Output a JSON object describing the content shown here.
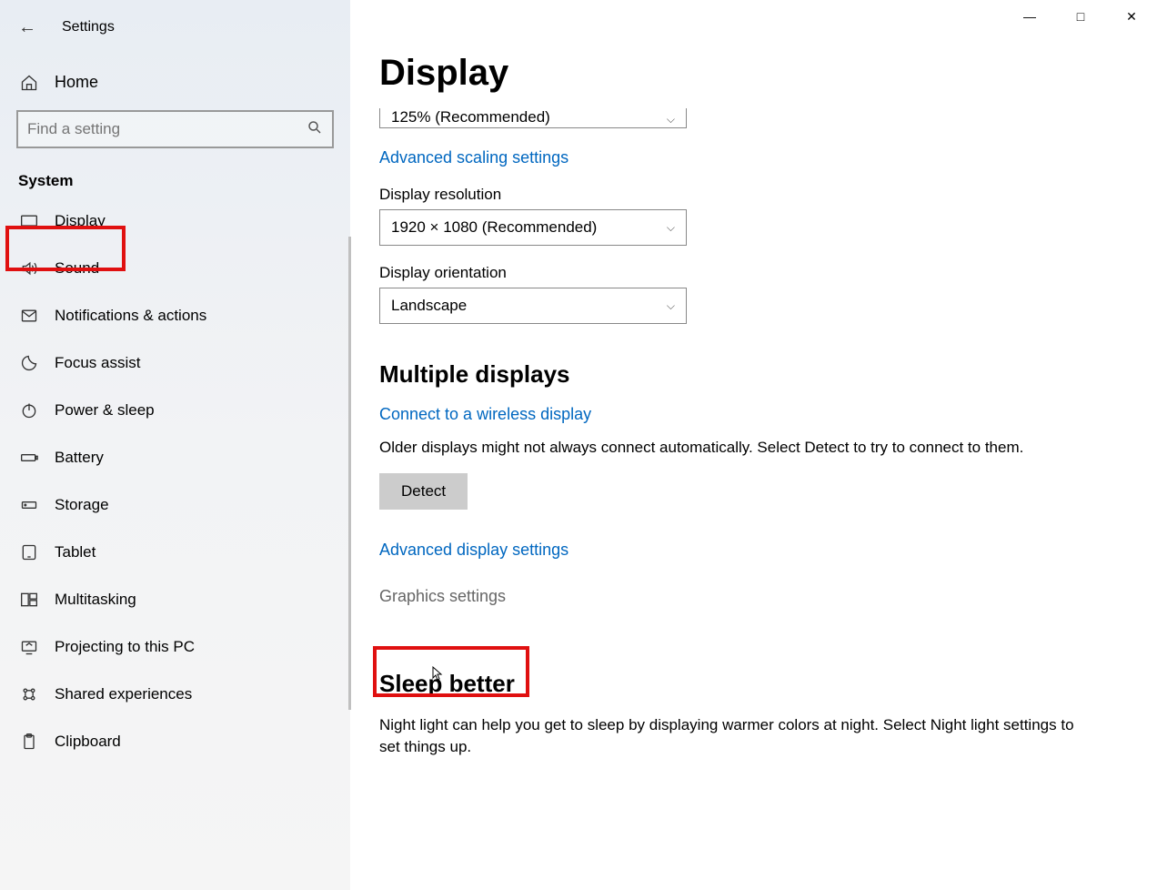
{
  "app_title": "Settings",
  "home_label": "Home",
  "search_placeholder": "Find a setting",
  "section_header": "System",
  "nav": [
    {
      "label": "Display"
    },
    {
      "label": "Sound"
    },
    {
      "label": "Notifications & actions"
    },
    {
      "label": "Focus assist"
    },
    {
      "label": "Power & sleep"
    },
    {
      "label": "Battery"
    },
    {
      "label": "Storage"
    },
    {
      "label": "Tablet"
    },
    {
      "label": "Multitasking"
    },
    {
      "label": "Projecting to this PC"
    },
    {
      "label": "Shared experiences"
    },
    {
      "label": "Clipboard"
    }
  ],
  "page": {
    "title": "Display",
    "scale_value": "125% (Recommended)",
    "adv_scaling_link": "Advanced scaling settings",
    "resolution_label": "Display resolution",
    "resolution_value": "1920 × 1080 (Recommended)",
    "orientation_label": "Display orientation",
    "orientation_value": "Landscape",
    "multi_title": "Multiple displays",
    "wireless_link": "Connect to a wireless display",
    "detect_help": "Older displays might not always connect automatically. Select Detect to try to connect to them.",
    "detect_btn": "Detect",
    "adv_display_link": "Advanced display settings",
    "graphics_link": "Graphics settings",
    "sleep_title": "Sleep better",
    "sleep_text": "Night light can help you get to sleep by displaying warmer colors at night. Select Night light settings to set things up."
  }
}
